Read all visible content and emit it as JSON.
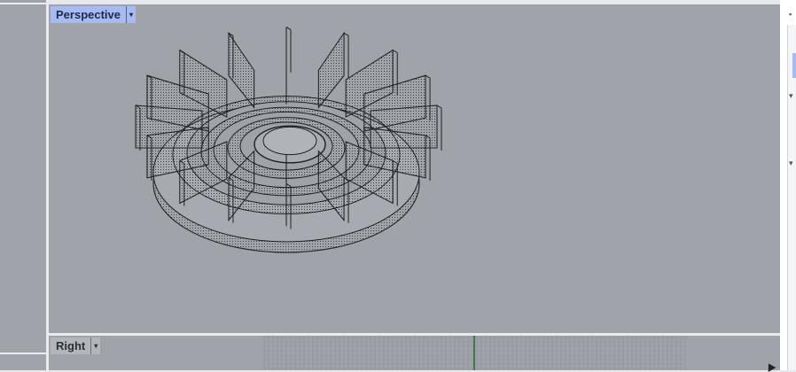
{
  "viewports": {
    "perspective": {
      "label": "Perspective",
      "active": true
    },
    "right": {
      "label": "Right",
      "active": false
    }
  },
  "dropdown_glyph": "▾",
  "colors": {
    "viewport_bg": "#a0a4aa",
    "active_tab": "#a7baf2",
    "separator": "#e9ebee",
    "wire": "#1d1f22",
    "grid_line": "#8e9298",
    "axis_green": "#2f6b33"
  },
  "model": {
    "name": "impeller-wireframe",
    "blade_count": 16
  }
}
